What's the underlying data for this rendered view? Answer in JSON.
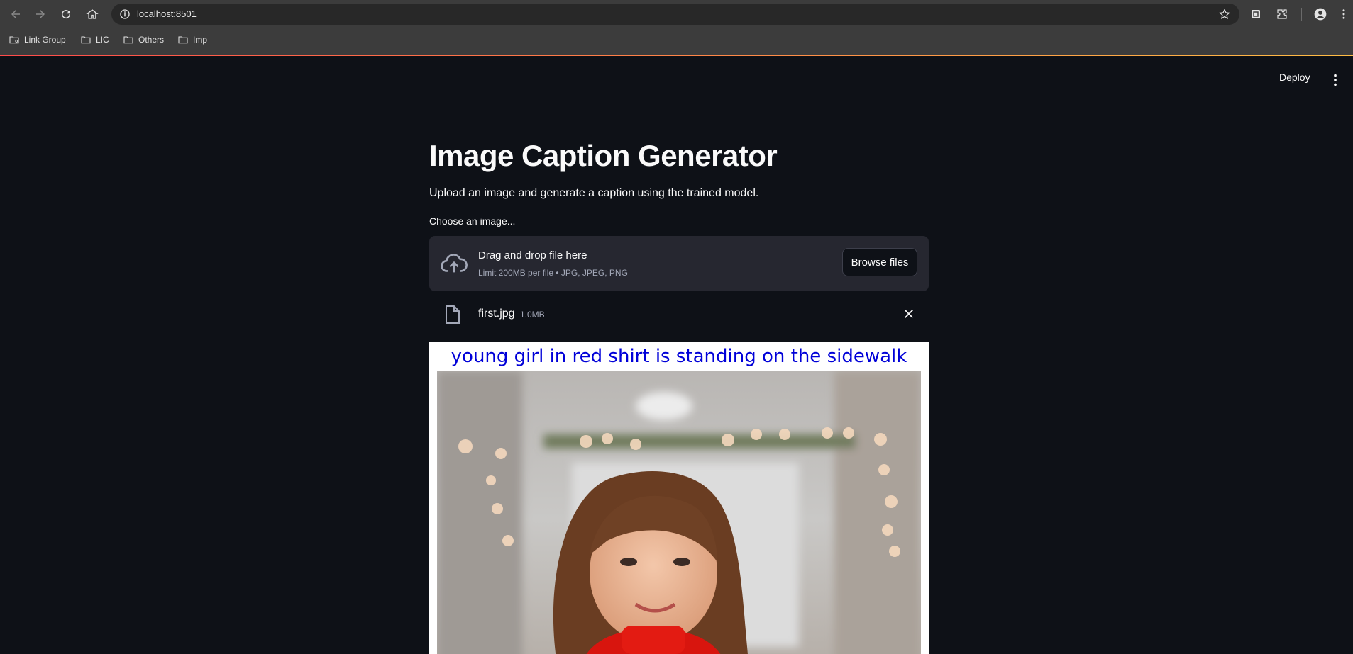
{
  "browser": {
    "url": "localhost:8501",
    "bookmarks": [
      {
        "label": "Link Group",
        "icon": "folder-group-icon"
      },
      {
        "label": "LIC",
        "icon": "folder-icon"
      },
      {
        "label": "Others",
        "icon": "folder-icon"
      },
      {
        "label": "Imp",
        "icon": "folder-icon"
      }
    ]
  },
  "header": {
    "deploy_label": "Deploy"
  },
  "main": {
    "title": "Image Caption Generator",
    "subtitle": "Upload an image and generate a caption using the trained model.",
    "uploader": {
      "label": "Choose an image...",
      "drop_title": "Drag and drop file here",
      "drop_limits": "Limit 200MB per file • JPG, JPEG, PNG",
      "browse_label": "Browse files"
    },
    "file": {
      "name": "first.jpg",
      "size": "1.0MB"
    },
    "result": {
      "caption": "young girl in red shirt is standing on the sidewalk"
    }
  },
  "colors": {
    "app_bg": "#0e1117",
    "panel_bg": "#262730",
    "caption_text": "#0000d8",
    "accent_start": "#ff4b4b",
    "accent_end": "#ffbd45"
  }
}
